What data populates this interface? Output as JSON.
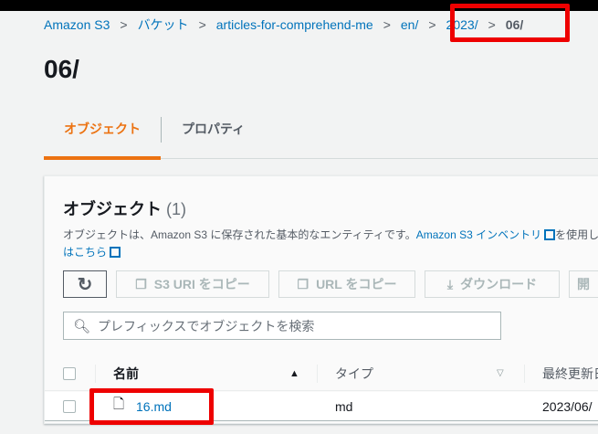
{
  "breadcrumb": {
    "items": [
      "Amazon S3",
      "バケット",
      "articles-for-comprehend-me",
      "en/",
      "2023/"
    ],
    "current": "06/"
  },
  "title": "06/",
  "tabs": [
    {
      "label": "オブジェクト",
      "active": true
    },
    {
      "label": "プロパティ",
      "active": false
    }
  ],
  "panel": {
    "heading": "オブジェクト",
    "count": "(1)",
    "desc_text": "オブジェクトは、Amazon S3 に保存された基本的なエンティティです。",
    "desc_link": "Amazon S3 インベントリ",
    "desc_tail": "を使用し",
    "desc_link2": "はこちら",
    "buttons": {
      "copy_s3_uri": "S3 URI をコピー",
      "copy_url": "URL をコピー",
      "download": "ダウンロード",
      "open": "開"
    },
    "search_placeholder": "プレフィックスでオブジェクトを検索",
    "columns": {
      "name": "名前",
      "type": "タイプ",
      "modified": "最終更新日"
    },
    "rows": [
      {
        "name": "16.md",
        "type": "md",
        "modified": "2023/06/"
      }
    ]
  },
  "colors": {
    "accent": "#ec7211",
    "link": "#0073bb",
    "highlight": "#e00000"
  }
}
